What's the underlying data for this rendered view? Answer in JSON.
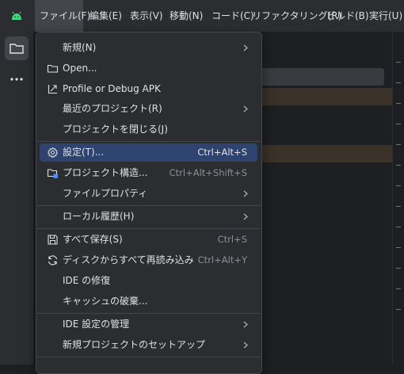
{
  "menubar": {
    "items": [
      {
        "label": "ファイル(F)"
      },
      {
        "label": "編集(E)"
      },
      {
        "label": "表示(V)"
      },
      {
        "label": "移動(N)"
      },
      {
        "label": "コード(C)"
      },
      {
        "label": "リファクタリング(R)"
      },
      {
        "label": "ビルド(B)"
      },
      {
        "label": "実行(U)"
      }
    ]
  },
  "toolstrip": {
    "project_icon": "folder-icon",
    "more_icon": "more-horizontal-icon"
  },
  "file_menu": {
    "items": [
      {
        "label": "新規(N)",
        "submenu": true
      },
      {
        "label": "Open...",
        "icon": "folder-icon"
      },
      {
        "label": "Profile or Debug APK",
        "icon": "profile-apk-icon"
      },
      {
        "label": "最近のプロジェクト(R)",
        "submenu": true
      },
      {
        "label": "プロジェクトを閉じる(J)"
      },
      {
        "label": "設定(T)...",
        "icon": "gear-icon",
        "shortcut": "Ctrl+Alt+S",
        "selected": true
      },
      {
        "label": "プロジェクト構造...",
        "icon": "project-structure-icon",
        "shortcut": "Ctrl+Alt+Shift+S"
      },
      {
        "label": "ファイルプロパティ",
        "submenu": true
      },
      {
        "label": "ローカル履歴(H)",
        "submenu": true
      },
      {
        "label": "すべて保存(S)",
        "icon": "save-icon",
        "shortcut": "Ctrl+S"
      },
      {
        "label": "ディスクからすべて再読み込み",
        "icon": "reload-icon",
        "shortcut": "Ctrl+Alt+Y"
      },
      {
        "label": "IDE の修復"
      },
      {
        "label": "キャッシュの破棄..."
      },
      {
        "label": "IDE 設定の管理",
        "submenu": true
      },
      {
        "label": "新規プロジェクトのセットアップ",
        "submenu": true
      }
    ]
  },
  "colors": {
    "accent_selection": "#2e436e",
    "android_green": "#3ddc84"
  }
}
